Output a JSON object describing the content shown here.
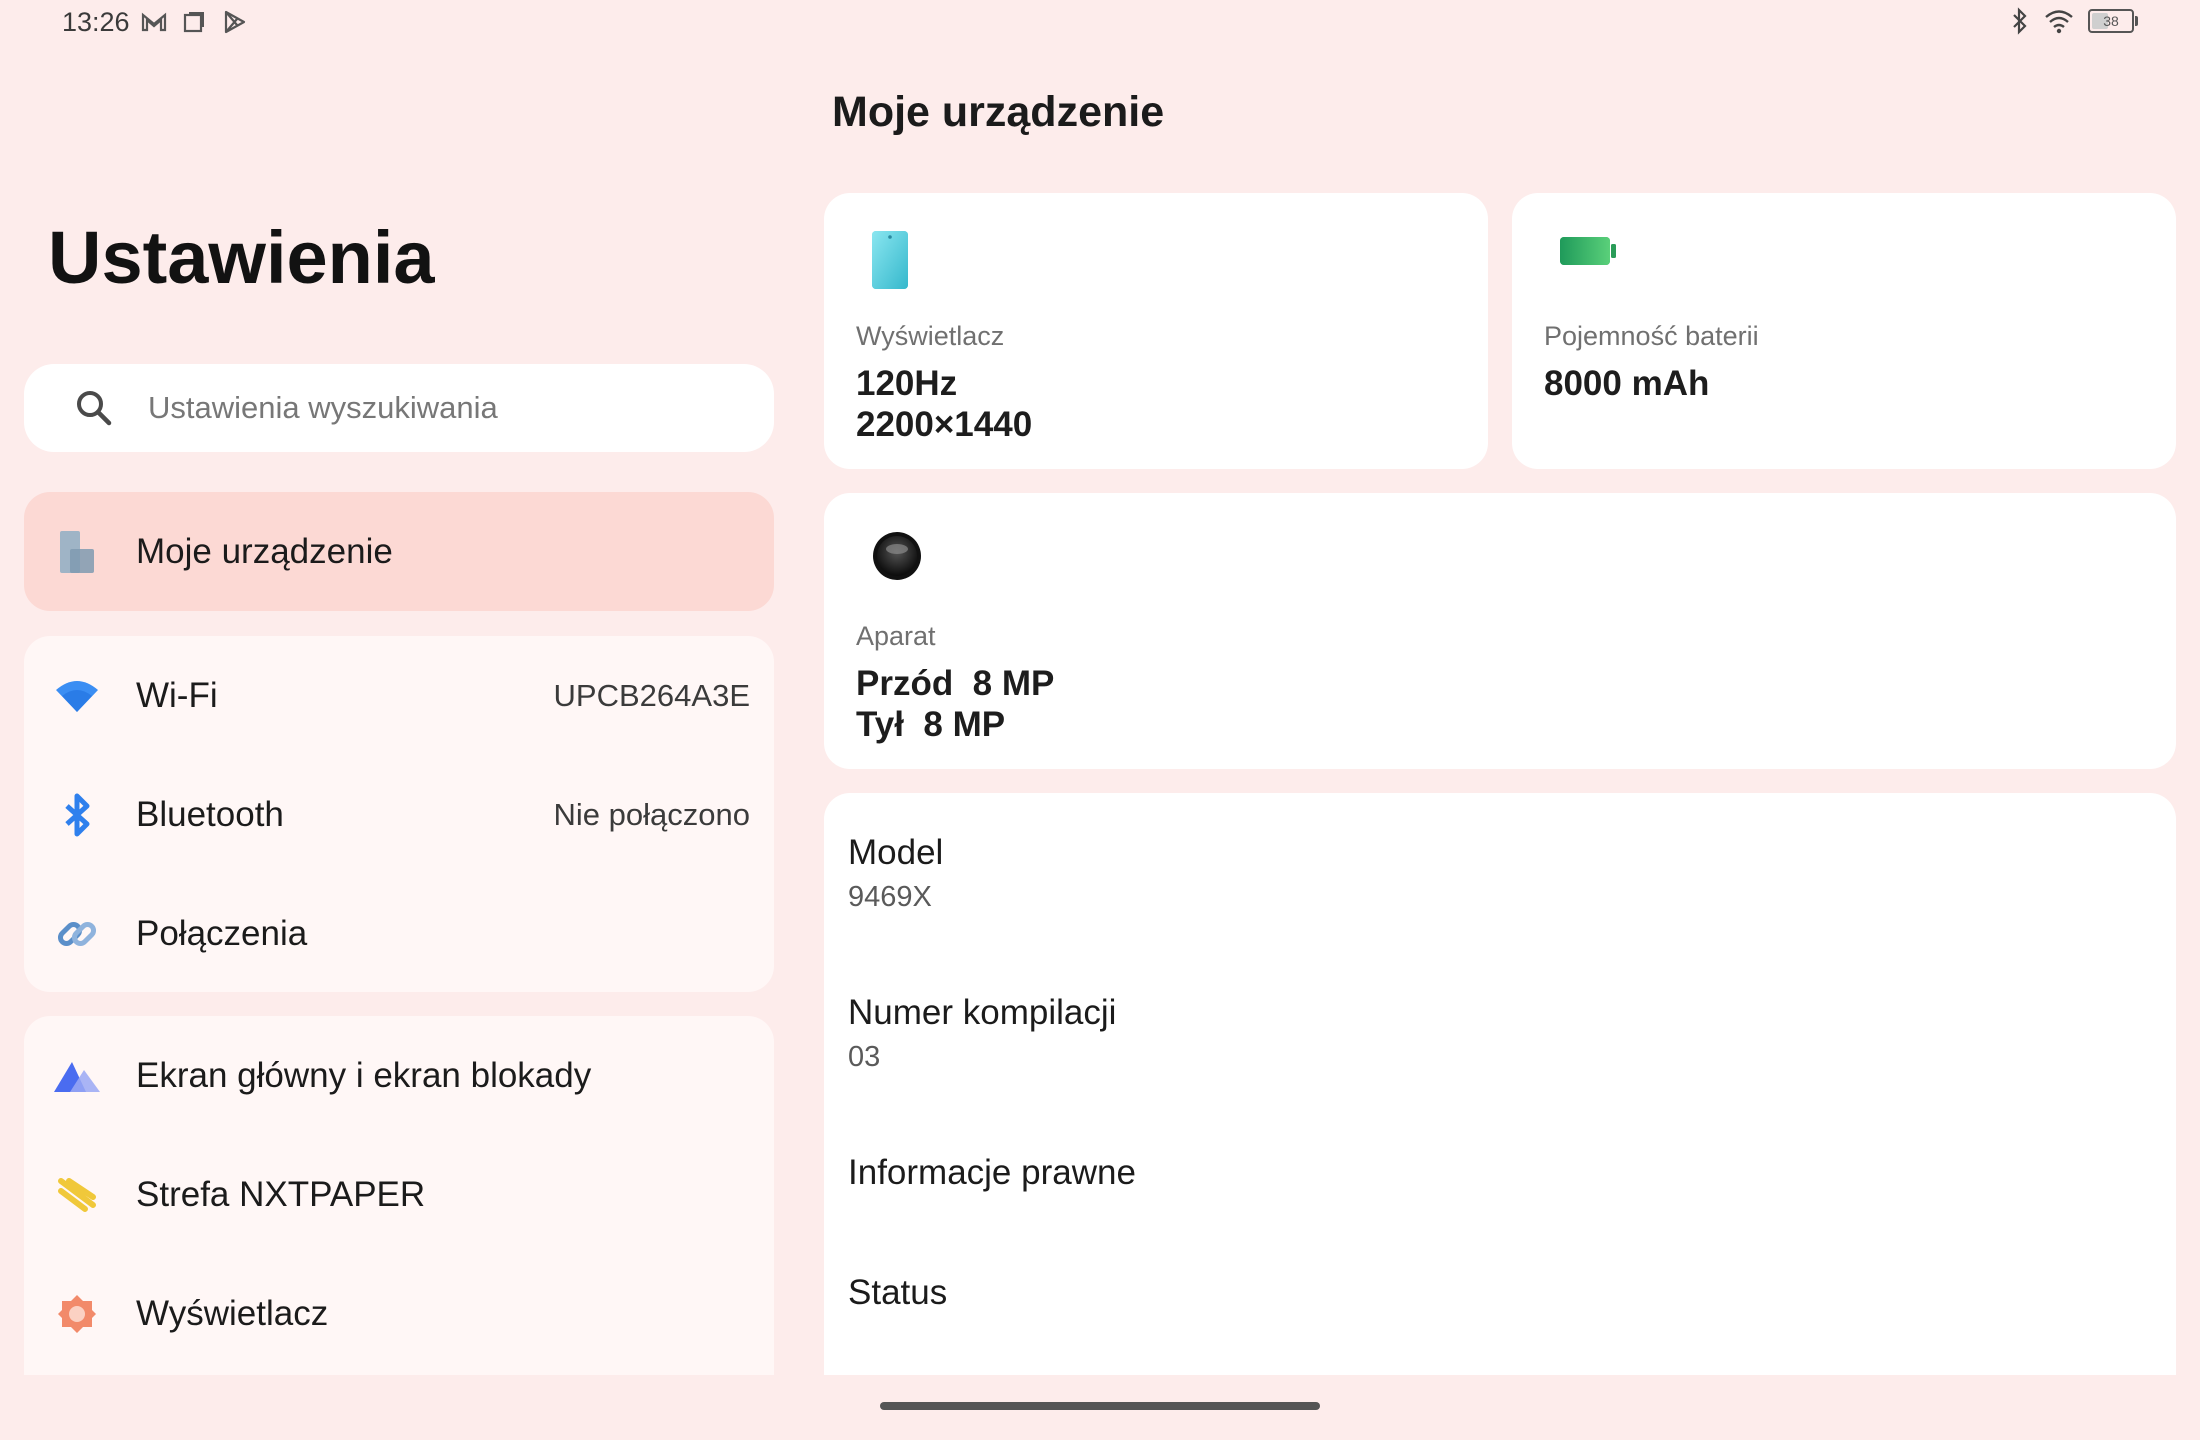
{
  "status_bar": {
    "time": "13:26",
    "left_icons": [
      "gmail-icon",
      "square-app-icon",
      "play-store-icon"
    ],
    "right_icons": [
      "bluetooth-icon",
      "wifi-icon",
      "battery-icon"
    ],
    "battery_level": "38"
  },
  "left": {
    "title": "Ustawienia",
    "search": {
      "placeholder": "Ustawienia wyszukiwania",
      "icon": "search-icon"
    },
    "selected_item": {
      "label": "Moje urządzenie",
      "icon": "device-icon"
    },
    "group1": [
      {
        "label": "Wi-Fi",
        "value": "UPCB264A3E",
        "icon": "wifi-icon"
      },
      {
        "label": "Bluetooth",
        "value": "Nie połączono",
        "icon": "bluetooth-icon"
      },
      {
        "label": "Połączenia",
        "value": "",
        "icon": "link-icon"
      }
    ],
    "group2": [
      {
        "label": "Ekran główny i ekran blokady",
        "icon": "mountain-icon"
      },
      {
        "label": "Strefa NXTPAPER",
        "icon": "nxtpaper-icon"
      },
      {
        "label": "Wyświetlacz",
        "icon": "display-gear-icon"
      }
    ]
  },
  "right": {
    "title": "Moje urządzenie",
    "display": {
      "label": "Wyświetlacz",
      "line1": "120Hz",
      "line2": "2200×1440"
    },
    "battery": {
      "label": "Pojemność baterii",
      "value": "8000 mAh"
    },
    "camera": {
      "label": "Aparat",
      "front": "Przód  8 MP",
      "rear": "Tył  8 MP"
    },
    "info": [
      {
        "key": "Model",
        "value": "9469X"
      },
      {
        "key": "Numer kompilacji",
        "value": "03"
      },
      {
        "key": "Informacje prawne",
        "value": ""
      },
      {
        "key": "Status",
        "value": ""
      }
    ]
  },
  "colors": {
    "background": "#fdeceb",
    "selected": "#fcd9d4",
    "accent_blue": "#3b8ef3"
  }
}
